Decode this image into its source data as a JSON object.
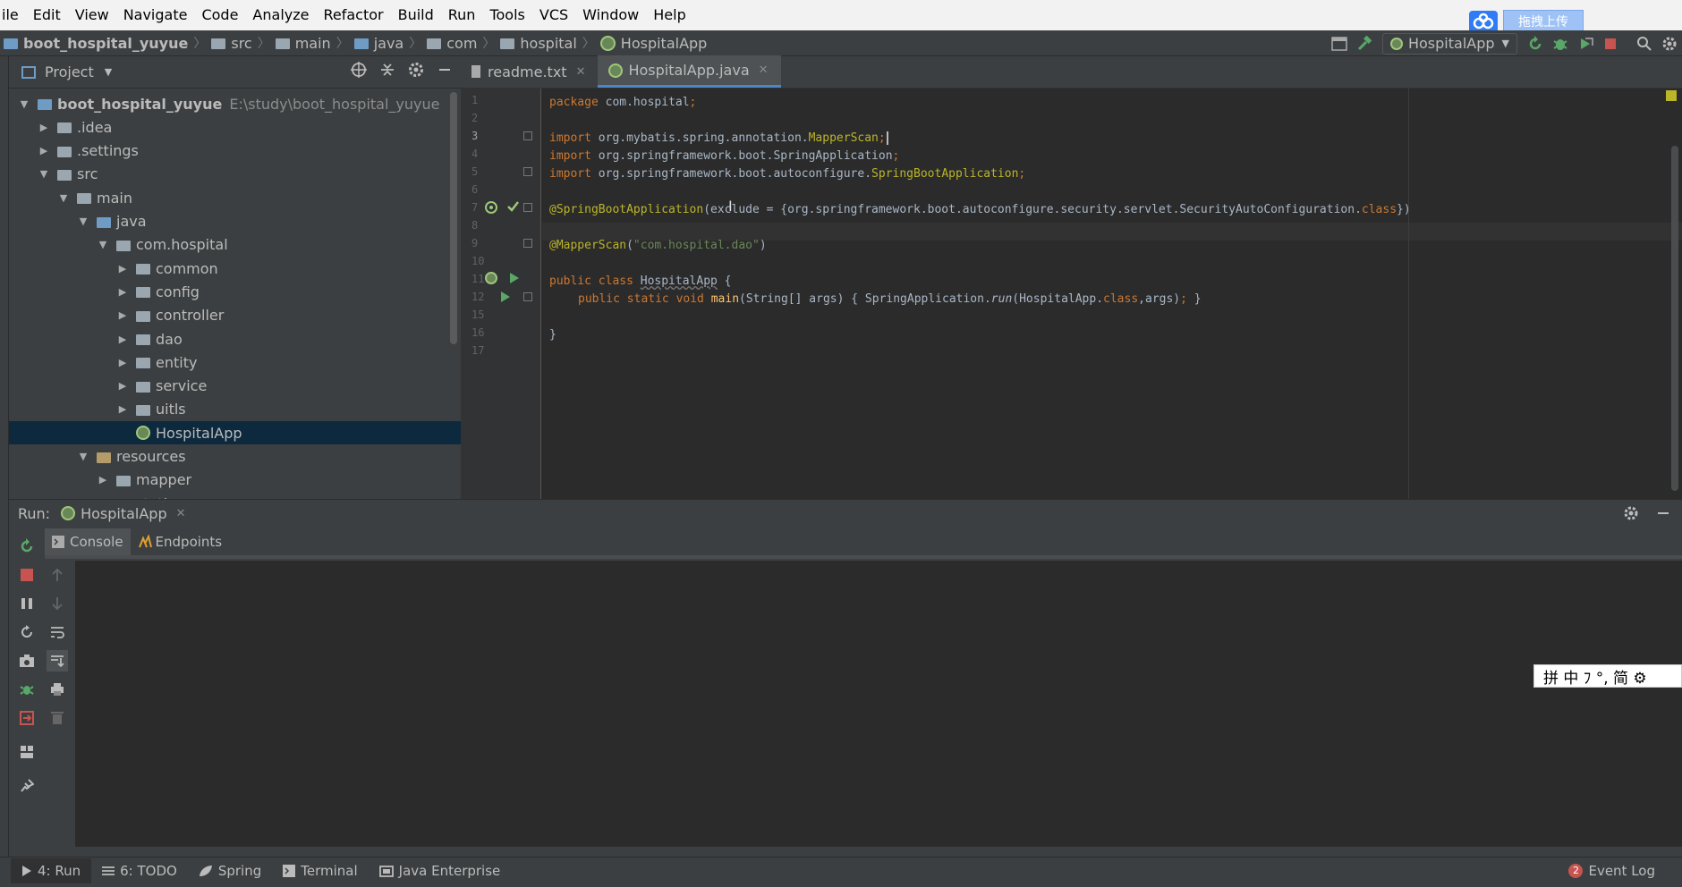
{
  "menu": {
    "items": [
      "ile",
      "Edit",
      "View",
      "Navigate",
      "Code",
      "Analyze",
      "Refactor",
      "Build",
      "Run",
      "Tools",
      "VCS",
      "Window",
      "Help"
    ],
    "upload_label": "拖拽上传"
  },
  "navbar": {
    "crumbs": [
      "boot_hospital_yuyue",
      "src",
      "main",
      "java",
      "com",
      "hospital",
      "HospitalApp"
    ],
    "run_config": "HospitalApp"
  },
  "project": {
    "header": "Project",
    "tree": [
      {
        "label": "boot_hospital_yuyue",
        "extra": "E:\\study\\boot_hospital_yuyue",
        "depth": 0,
        "arrow": "▼",
        "icon": "module-folder",
        "bold": true
      },
      {
        "label": ".idea",
        "depth": 1,
        "arrow": "▶",
        "icon": "folder"
      },
      {
        "label": ".settings",
        "depth": 1,
        "arrow": "▶",
        "icon": "folder"
      },
      {
        "label": "src",
        "depth": 1,
        "arrow": "▼",
        "icon": "folder"
      },
      {
        "label": "main",
        "depth": 2,
        "arrow": "▼",
        "icon": "folder"
      },
      {
        "label": "java",
        "depth": 3,
        "arrow": "▼",
        "icon": "source-folder"
      },
      {
        "label": "com.hospital",
        "depth": 4,
        "arrow": "▼",
        "icon": "package"
      },
      {
        "label": "common",
        "depth": 5,
        "arrow": "▶",
        "icon": "package"
      },
      {
        "label": "config",
        "depth": 5,
        "arrow": "▶",
        "icon": "package"
      },
      {
        "label": "controller",
        "depth": 5,
        "arrow": "▶",
        "icon": "package"
      },
      {
        "label": "dao",
        "depth": 5,
        "arrow": "▶",
        "icon": "package"
      },
      {
        "label": "entity",
        "depth": 5,
        "arrow": "▶",
        "icon": "package"
      },
      {
        "label": "service",
        "depth": 5,
        "arrow": "▶",
        "icon": "package"
      },
      {
        "label": "uitls",
        "depth": 5,
        "arrow": "▶",
        "icon": "package"
      },
      {
        "label": "HospitalApp",
        "depth": 5,
        "arrow": "",
        "icon": "spring-class",
        "selected": true
      },
      {
        "label": "resources",
        "depth": 3,
        "arrow": "▼",
        "icon": "resources-folder"
      },
      {
        "label": "mapper",
        "depth": 4,
        "arrow": "▶",
        "icon": "package"
      },
      {
        "label": "static",
        "depth": 4,
        "arrow": "▶",
        "icon": "package"
      }
    ]
  },
  "editor": {
    "tabs": [
      {
        "label": "readme.txt",
        "active": false
      },
      {
        "label": "HospitalApp.java",
        "active": true
      }
    ],
    "line_numbers": [
      "1",
      "2",
      "3",
      "4",
      "5",
      "6",
      "7",
      "8",
      "9",
      "10",
      "11",
      "12",
      "15",
      "16",
      "17"
    ],
    "code": {
      "l1_kw": "package",
      "l1_rest": " com.hospital",
      "l1_semi": ";",
      "l3_kw": "import",
      "l3_pkg": " org.mybatis.spring.annotation.",
      "l3_cls": "MapperScan",
      "l3_semi": ";",
      "l4_kw": "import",
      "l4_pkg": " org.springframework.boot.SpringApplication",
      "l4_semi": ";",
      "l5_kw": "import",
      "l5_pkg": " org.springframework.boot.autoconfigure.",
      "l5_cls": "SpringBootApplication",
      "l5_semi": ";",
      "l7_ann": "@SpringBootApplication",
      "l7_a": "(exclude = {org.springframework.boot.autoconfigure.security.servlet.SecurityAutoConfiguration.",
      "l7_kw": "class",
      "l7_b": "})",
      "l9_ann": "@MapperScan",
      "l9_a": "(",
      "l9_str": "\"com.hospital.dao\"",
      "l9_b": ")",
      "l11_kw": "public class ",
      "l11_cls": "HospitalApp",
      "l11_rest": " {",
      "l12_kw": "public static void ",
      "l12_m": "main",
      "l12_a": "(String[] args) { SpringApplication.",
      "l12_run": "run",
      "l12_b": "(HospitalApp.",
      "l12_kw2": "class",
      "l12_c": ",args)",
      "l12_semi": ";",
      "l12_d": " }",
      "l16": "}"
    }
  },
  "run": {
    "label": "Run:",
    "config": "HospitalApp",
    "tabs": [
      "Console",
      "Endpoints"
    ]
  },
  "toolstrip": {
    "items": [
      {
        "label": "4: Run",
        "icon": "run-icon",
        "active": true
      },
      {
        "label": "6: TODO",
        "icon": "list-icon"
      },
      {
        "label": "Spring",
        "icon": "spring-icon"
      },
      {
        "label": "Terminal",
        "icon": "terminal-icon"
      },
      {
        "label": "Java Enterprise",
        "icon": "enterprise-icon"
      }
    ],
    "event_log": "Event Log",
    "event_count": "2"
  },
  "ime": {
    "text": "拼 中 ﾌ °, 简 ⚙"
  },
  "colors": {
    "accent": "#4a88c7",
    "selection": "#0d293e",
    "bg_dark": "#2b2b2b",
    "panel": "#3c3f41"
  }
}
